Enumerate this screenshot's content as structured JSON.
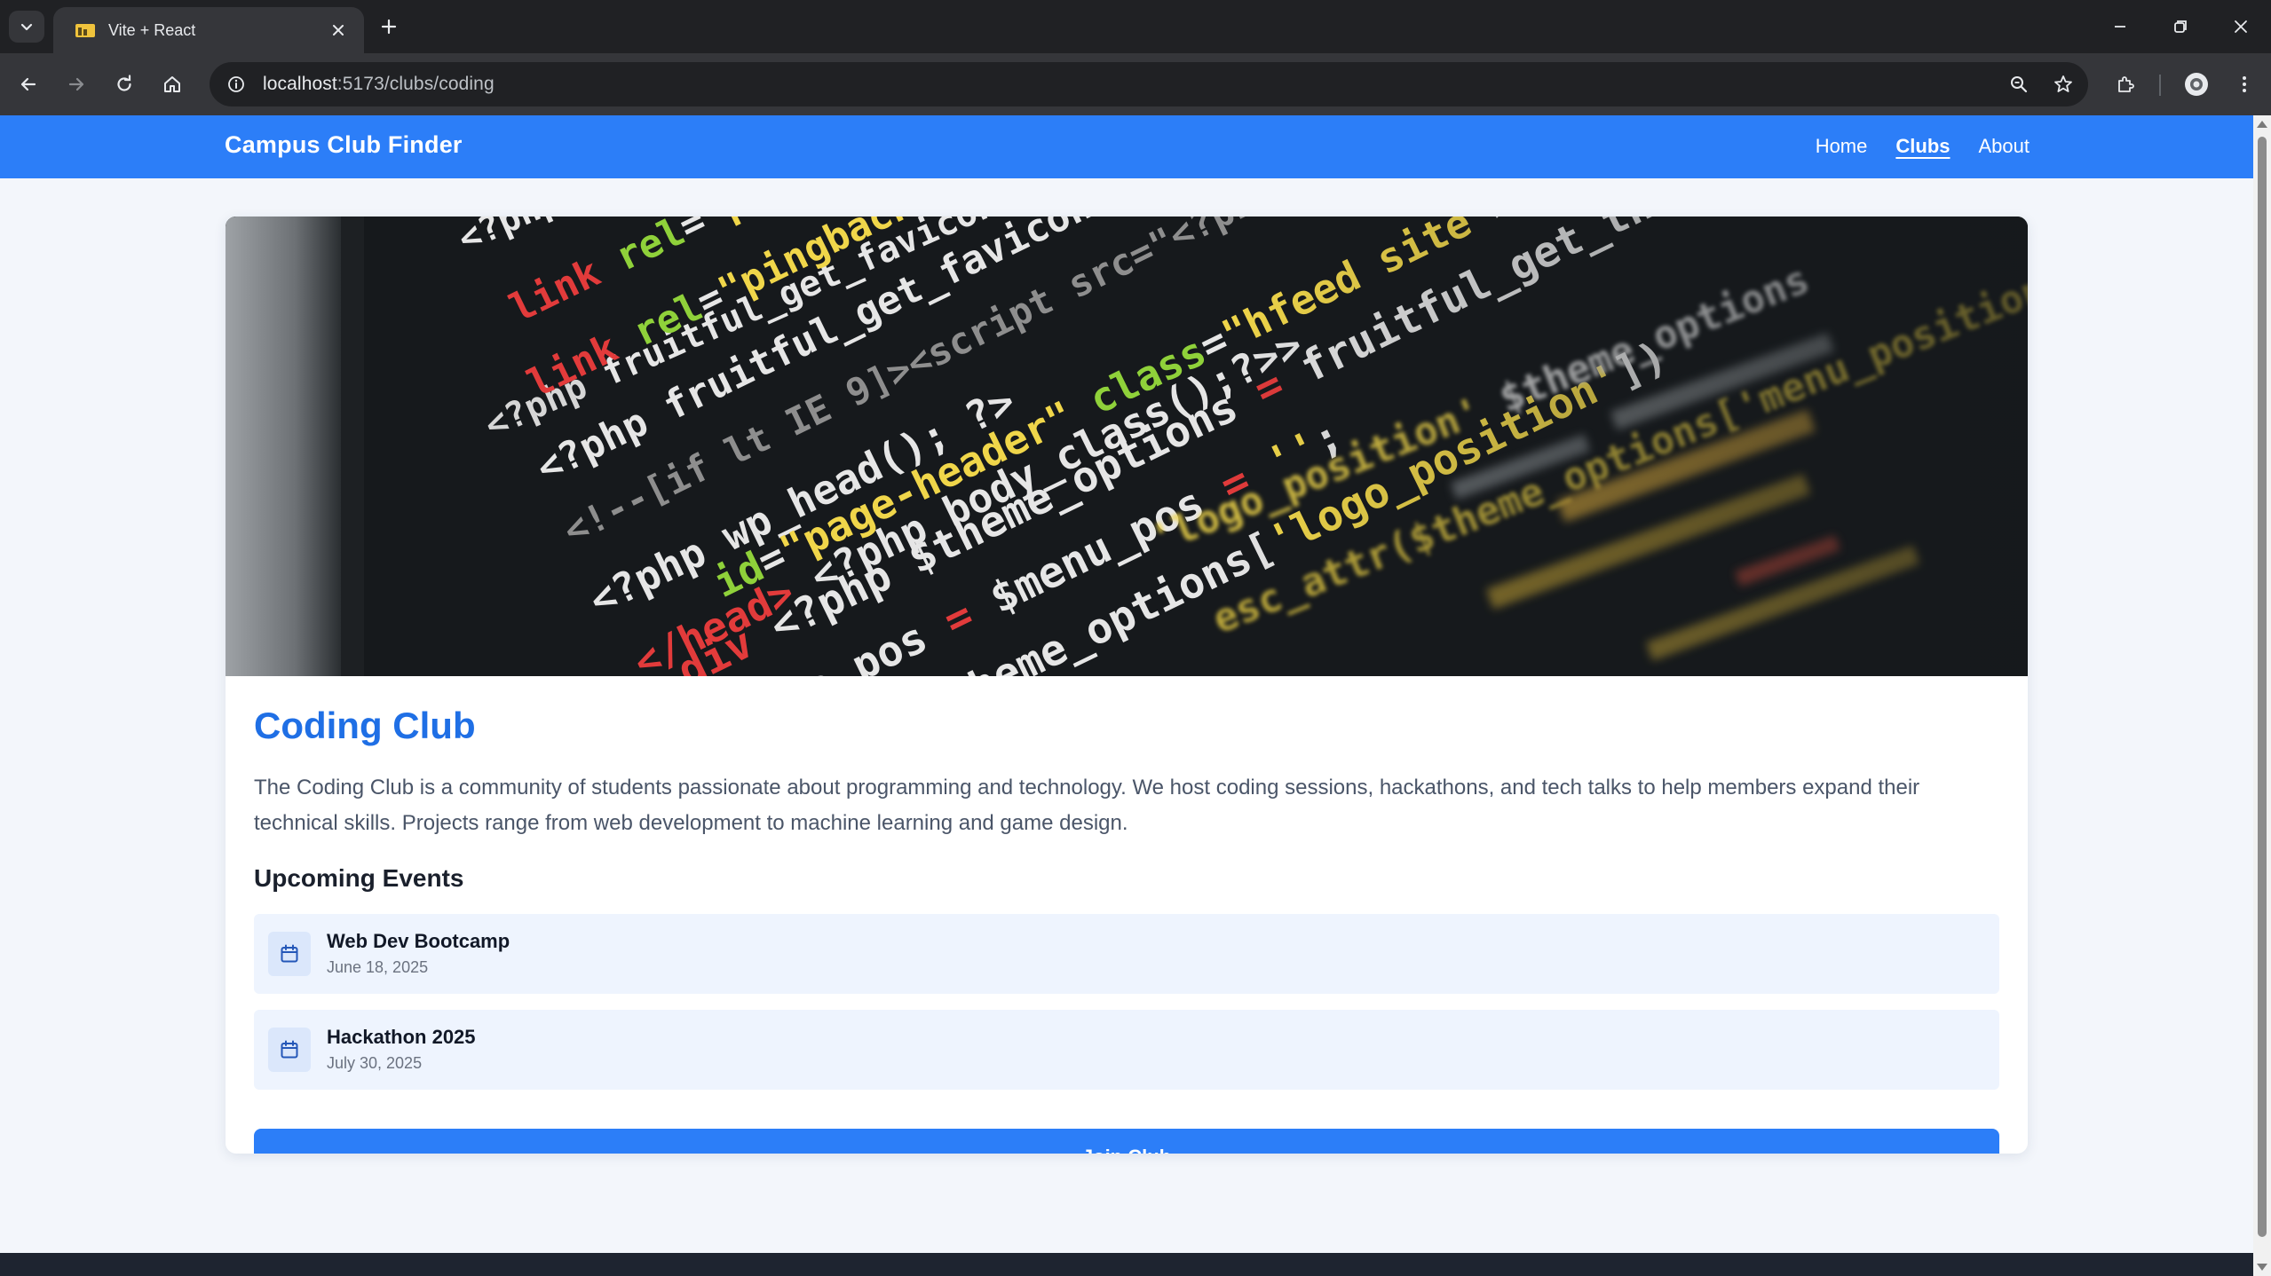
{
  "browser": {
    "tab_title": "Vite + React",
    "url_host": "localhost",
    "url_rest": ":5173/clubs/coding",
    "favicon_color": "#f0c33c"
  },
  "nav": {
    "brand": "Campus Club Finder",
    "links": [
      "Home",
      "Clubs",
      "About"
    ],
    "active": "Clubs",
    "color": "#2c7ef8"
  },
  "club": {
    "title": "Coding Club",
    "description": "The Coding Club is a community of students passionate about programming and technology. We host coding sessions, hackathons, and tech talks to help members expand their technical skills. Projects range from web development to machine learning and game design.",
    "hero_image": "code-editor-photo"
  },
  "events": {
    "heading": "Upcoming Events",
    "items": [
      {
        "name": "Web Dev Bootcamp",
        "date": "June 18, 2025"
      },
      {
        "name": "Hackathon 2025",
        "date": "July 30, 2025"
      }
    ]
  },
  "join_button": "Join Club"
}
